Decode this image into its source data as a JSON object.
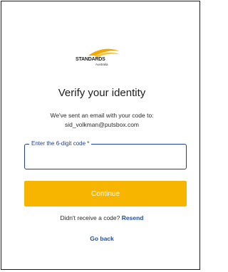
{
  "logo": {
    "wordmark": "STANDARDS",
    "sub": "Australia",
    "accent_color": "#f2a900"
  },
  "title": "Verify your identity",
  "message_line1": "We've sent an email with your code to:",
  "message_email": "sid_volkman@putsbox.com",
  "code_field": {
    "label": "Enter the 6-digit code *",
    "value": ""
  },
  "continue_label": "Continue",
  "resend": {
    "prompt": "Didn't receive a code?",
    "link_label": "Resend"
  },
  "go_back_label": "Go back",
  "colors": {
    "primary_button": "#f7b500",
    "link": "#1f4fa8",
    "field_border": "#1f3f8f"
  }
}
